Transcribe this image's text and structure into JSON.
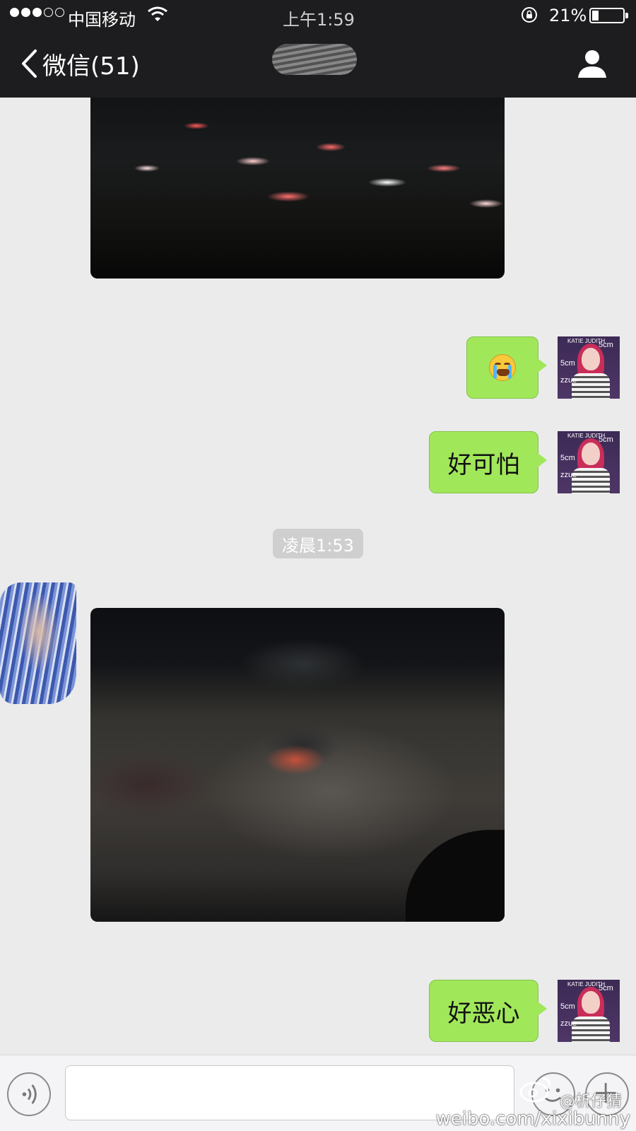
{
  "status_bar": {
    "signal_bars_filled": 3,
    "signal_bars_total": 5,
    "carrier": "中国移动",
    "time": "上午1:59",
    "battery_percent": "21%",
    "battery_level": 0.21
  },
  "nav": {
    "back_label": "微信(51)",
    "title": "",
    "profile_icon": "person-icon"
  },
  "messages": [
    {
      "type": "image",
      "from": "other",
      "description": ""
    },
    {
      "type": "emoji",
      "from": "me",
      "icon": "crying-face-icon"
    },
    {
      "type": "text",
      "from": "me",
      "text": "好可怕"
    },
    {
      "type": "timestamp",
      "text": "凌晨1:53"
    },
    {
      "type": "image",
      "from": "other"
    },
    {
      "type": "text",
      "from": "me",
      "text": "好恶心"
    }
  ],
  "me_avatar": {
    "label_top": "KATIE JUDITH",
    "label_5cm_a": "5cm",
    "label_5cm_b": "5cm",
    "label_side": "zzue"
  },
  "input_bar": {
    "value": "",
    "voice_icon": "voice-icon",
    "emoji_icon": "emoji-icon",
    "more_icon": "plus-icon"
  },
  "watermark": {
    "handle": "@析仔猜",
    "url": "weibo.com/xixibunny"
  },
  "colors": {
    "bar_bg": "#1d1d1f",
    "chat_bg": "#ebebeb",
    "bubble_green": "#a0e75a",
    "timestamp_bg": "#cfcfcf"
  }
}
